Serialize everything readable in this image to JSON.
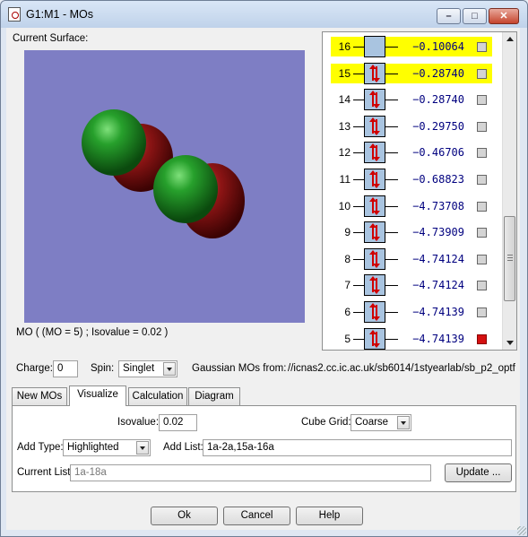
{
  "window": {
    "title": "G1:M1 - MOs"
  },
  "surface": {
    "label": "Current Surface:",
    "caption": "MO ( (MO = 5) ; Isovalue = 0.02 )",
    "background_color": "#7e7ec4",
    "lobe_colors": {
      "positive": "#1e9a25",
      "negative": "#8a1010"
    }
  },
  "mo_list": [
    {
      "num": "16",
      "energy": "−0.10064",
      "occupancy": "empty",
      "highlighted": true,
      "checked": false
    },
    {
      "num": "15",
      "energy": "−0.28740",
      "occupancy": "paired",
      "highlighted": true,
      "checked": false
    },
    {
      "num": "14",
      "energy": "−0.28740",
      "occupancy": "paired",
      "highlighted": false,
      "checked": false
    },
    {
      "num": "13",
      "energy": "−0.29750",
      "occupancy": "paired",
      "highlighted": false,
      "checked": false
    },
    {
      "num": "12",
      "energy": "−0.46706",
      "occupancy": "paired",
      "highlighted": false,
      "checked": false
    },
    {
      "num": "11",
      "energy": "−0.68823",
      "occupancy": "paired",
      "highlighted": false,
      "checked": false
    },
    {
      "num": "10",
      "energy": "−4.73708",
      "occupancy": "paired",
      "highlighted": false,
      "checked": false
    },
    {
      "num": "9",
      "energy": "−4.73909",
      "occupancy": "paired",
      "highlighted": false,
      "checked": false
    },
    {
      "num": "8",
      "energy": "−4.74124",
      "occupancy": "paired",
      "highlighted": false,
      "checked": false
    },
    {
      "num": "7",
      "energy": "−4.74124",
      "occupancy": "paired",
      "highlighted": false,
      "checked": false
    },
    {
      "num": "6",
      "energy": "−4.74139",
      "occupancy": "paired",
      "highlighted": false,
      "checked": false
    },
    {
      "num": "5",
      "energy": "−4.74139",
      "occupancy": "paired",
      "highlighted": false,
      "checked": true
    }
  ],
  "charge": {
    "label": "Charge:",
    "value": "0"
  },
  "spin": {
    "label": "Spin:",
    "value": "Singlet"
  },
  "gaussian": {
    "label": "Gaussian MOs from:",
    "path": "//icnas2.cc.ic.ac.uk/sb6014/1styearlab/sb_p2_optf"
  },
  "tabs": [
    "New MOs",
    "Visualize",
    "Calculation",
    "Diagram"
  ],
  "active_tab": "Visualize",
  "visualize": {
    "isovalue_label": "Isovalue:",
    "isovalue": "0.02",
    "cube_grid_label": "Cube Grid:",
    "cube_grid": "Coarse",
    "add_type_label": "Add Type:",
    "add_type": "Highlighted",
    "add_list_label": "Add List:",
    "add_list": "1a-2a,15a-16a",
    "current_list_label": "Current List:",
    "current_list": "1a-18a",
    "update_label": "Update ..."
  },
  "buttons": {
    "ok": "Ok",
    "cancel": "Cancel",
    "help": "Help"
  },
  "colors": {
    "highlight": "#ffff00",
    "electron_arrow": "#d00000",
    "energy_text": "#00007f"
  }
}
